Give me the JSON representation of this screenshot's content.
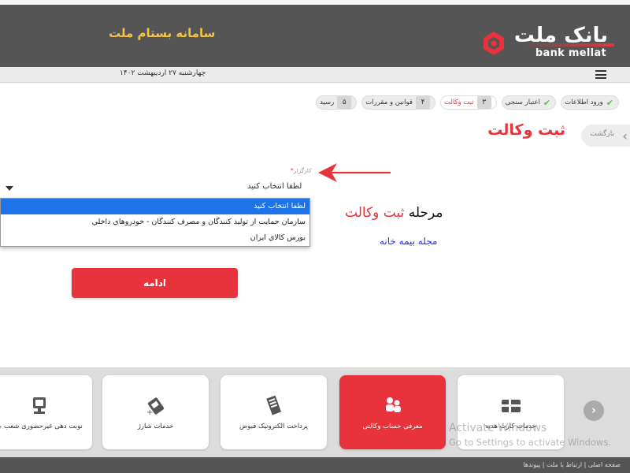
{
  "header": {
    "title": "سامانه بستام ملت",
    "logo_fa": "بانک ملت",
    "logo_en": "bank mellat"
  },
  "subbar": {
    "date": "چهارشنبه ۲۷ اردیبهشت ۱۴۰۲"
  },
  "steps": [
    {
      "label": "ورود اطلاعات",
      "marker": "check",
      "state": "done"
    },
    {
      "label": "اعتبار سنجی",
      "marker": "check",
      "state": "done"
    },
    {
      "label": "ثبت وکالت",
      "marker": "۳",
      "state": "active"
    },
    {
      "label": "قوانین و مقررات",
      "marker": "۴",
      "state": "pending"
    },
    {
      "label": "رسید",
      "marker": "۵",
      "state": "pending"
    }
  ],
  "back_label": "بازگشت",
  "page_title": "ثبت وکالت",
  "form": {
    "label": "کارگزار",
    "required_mark": "*",
    "value": "لطفا انتخاب کنید",
    "options": [
      "لطفا انتخاب کنید",
      "سازمان حمایت از تولید کنندگان و مصرف کنندگان - خودروهاي داخلي",
      "بورس كالاي ايران"
    ],
    "selected_index": 0
  },
  "annotation": {
    "line1_prefix": "مرحله ",
    "line1_highlight": "ثبت وکالت",
    "line2": "مجله بیمه خانه"
  },
  "continue_label": "ادامه",
  "services": [
    {
      "label": "خدمات کارت هدیه",
      "icon": "gift-card-icon"
    },
    {
      "label": "معرفی حساب وکالتی",
      "icon": "people-icon",
      "highlight": true
    },
    {
      "label": "پرداخت الکترونیک قبوض",
      "icon": "bill-icon"
    },
    {
      "label": "خدمات شارژ",
      "icon": "sim-card-icon"
    },
    {
      "label": "نوبت دهی غیرحضوری شعب ب",
      "icon": "queue-icon"
    }
  ],
  "watermark": {
    "line1": "Activate Windows",
    "line2": "Go to Settings to activate Windows."
  },
  "footer": {
    "links": "صفحه اصلی | ارتباط با ملت | پیوندها"
  },
  "colors": {
    "accent": "#e8323c",
    "header_bg": "#555555",
    "title_gold": "#f6c445",
    "selection_blue": "#1e73e8",
    "annotation_blue": "#2233ee"
  }
}
